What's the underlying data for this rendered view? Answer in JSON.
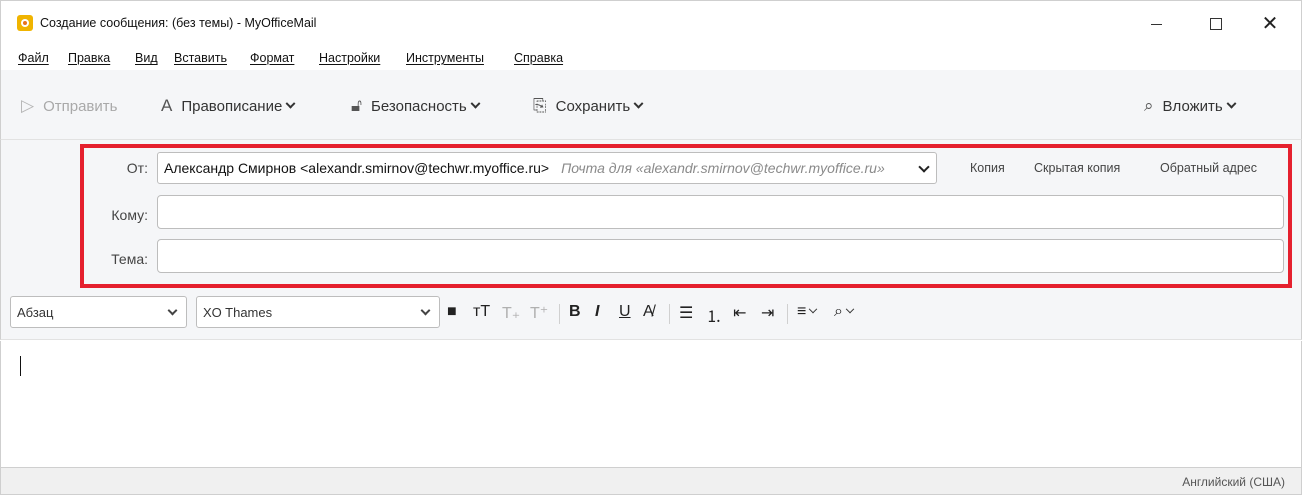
{
  "window": {
    "title": "Создание сообщения: (без темы) - MyOfficeMail",
    "minimize_label": "—",
    "maximize_label": "",
    "close_label": "✕"
  },
  "menu": [
    "Файл",
    "Правка",
    "Вид",
    "Вставить",
    "Формат",
    "Настройки",
    "Инструменты",
    "Справка"
  ],
  "toolbar": {
    "send_label": "Отправить",
    "spelling_label": "Правописание",
    "security_label": "Безопасность",
    "save_label": "Сохранить",
    "attach_label": "Вложить"
  },
  "header": {
    "from_label": "От:",
    "from_value": "Александр Смирнов <alexandr.smirnov@techwr.myoffice.ru>",
    "from_hint": "Почта для «alexandr.smirnov@techwr.myoffice.ru»",
    "cc_label": "Копия",
    "bcc_label": "Скрытая копия",
    "reply_to_label": "Обратный адрес",
    "to_label": "Кому:",
    "to_value": "",
    "subject_label": "Тема:",
    "subject_value": ""
  },
  "format": {
    "paragraph_style": "Абзац",
    "font_name": "XO Thames"
  },
  "editor": {
    "body": ""
  },
  "status": {
    "language": "Английский (США)"
  },
  "colors": {
    "highlight_border": "#e5202e",
    "app_icon": "#f0b400"
  }
}
